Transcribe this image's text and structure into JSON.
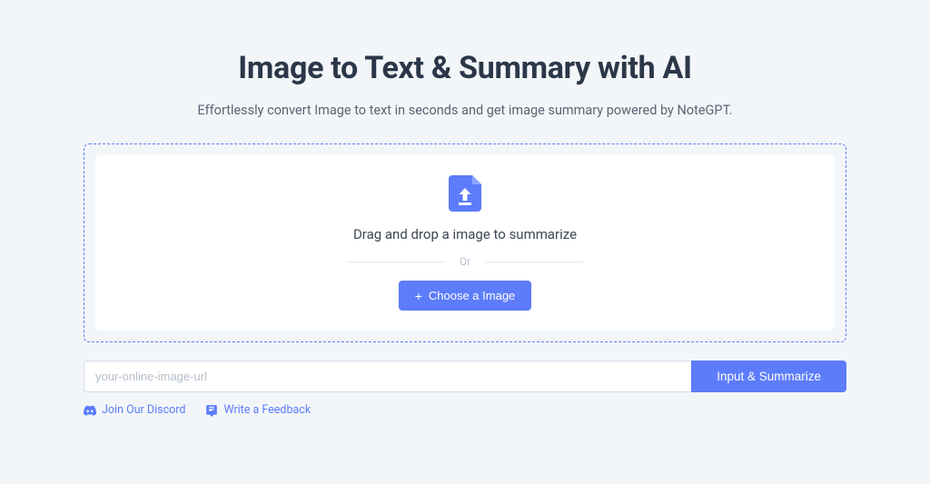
{
  "header": {
    "title": "Image to Text & Summary with AI",
    "subtitle": "Effortlessly convert Image to text in seconds and get image summary powered by NoteGPT."
  },
  "dropzone": {
    "drag_text": "Drag and drop a image to summarize",
    "or_text": "Or",
    "choose_label": "Choose a Image"
  },
  "url": {
    "placeholder": "your-online-image-url",
    "button_label": "Input & Summarize"
  },
  "links": {
    "discord": "Join Our Discord",
    "feedback": "Write a Feedback"
  },
  "colors": {
    "accent": "#5c7cfa"
  }
}
